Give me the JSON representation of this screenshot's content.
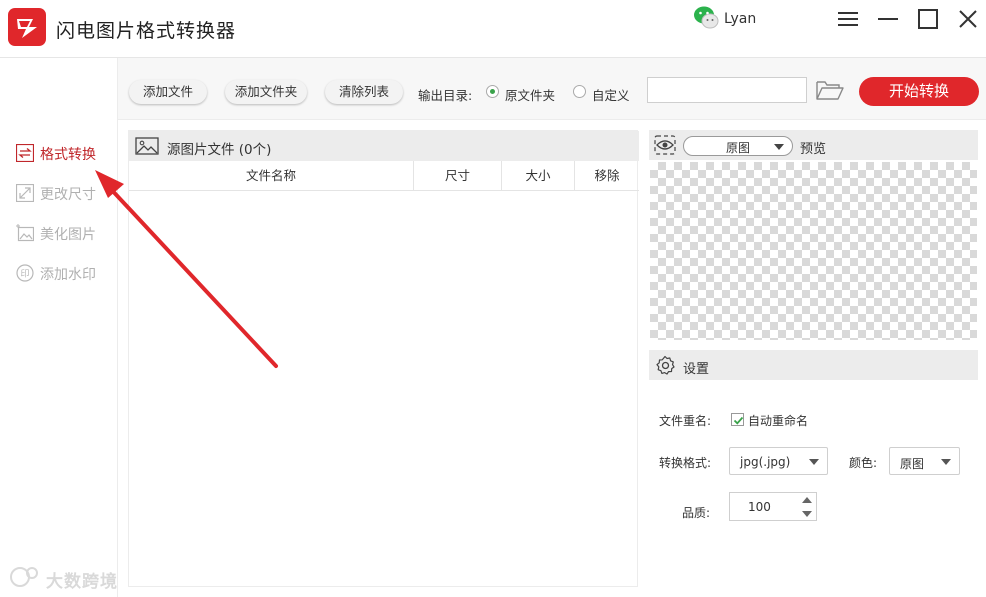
{
  "app": {
    "title": "闪电图片格式转换器",
    "brand_color": "#e0272b",
    "logo_icon": "lightning-logo-icon"
  },
  "user": {
    "name": "Lyan",
    "avatar_icon": "wechat-icon"
  },
  "window_controls": [
    "menu-icon",
    "minimize-icon",
    "maximize-icon",
    "close-icon"
  ],
  "sidebar": {
    "items": [
      {
        "label": "格式转换",
        "icon": "format-convert-icon",
        "active": true
      },
      {
        "label": "更改尺寸",
        "icon": "resize-icon",
        "active": false
      },
      {
        "label": "美化图片",
        "icon": "beautify-icon",
        "active": false
      },
      {
        "label": "添加水印",
        "icon": "watermark-icon",
        "active": false
      }
    ],
    "active_color": "#c0272b"
  },
  "toolbar": {
    "add_file": "添加文件",
    "add_folder": "添加文件夹",
    "clear_list": "清除列表",
    "output_label": "输出目录:",
    "radio_original": "原文件夹",
    "radio_custom": "自定义",
    "selected_output": "原文件夹",
    "path_value": "",
    "folder_icon": "folder-open-icon",
    "start_button": "开始转换"
  },
  "file_panel": {
    "title": "源图片文件 (0个)",
    "columns": [
      "文件名称",
      "尺寸",
      "大小",
      "移除"
    ],
    "rows": []
  },
  "preview": {
    "mode_value": "原图",
    "label": "预览",
    "icon": "eye-icon"
  },
  "settings": {
    "title": "设置",
    "icon": "gear-icon",
    "rename_label": "文件重名:",
    "auto_rename_label": "自动重命名",
    "auto_rename_checked": true,
    "format_label": "转换格式:",
    "format_value": "jpg(.jpg)",
    "color_label": "颜色:",
    "color_value": "原图",
    "quality_label": "品质:",
    "quality_value": "100"
  },
  "watermark_overlay": {
    "text": "大数跨境"
  }
}
